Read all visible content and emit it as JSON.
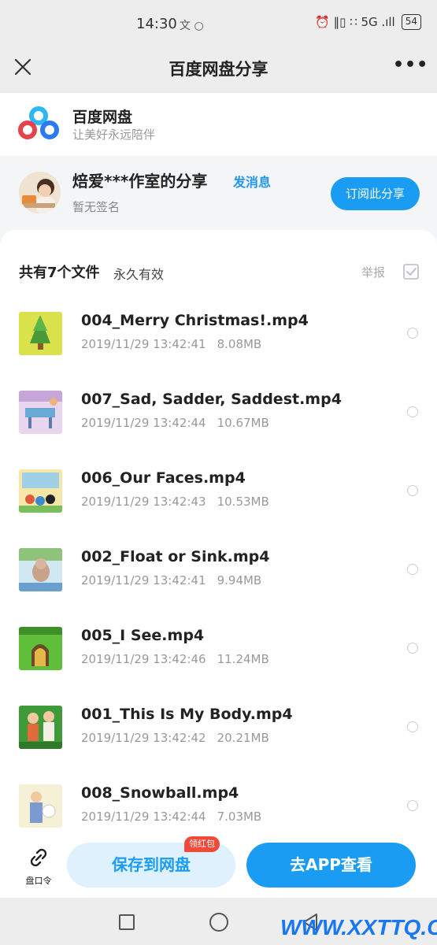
{
  "status_bar": {
    "time": "14:30",
    "time_extra": "文 ○",
    "icons_text": "⏰ ‖▯ ∷ 5G .ıll",
    "battery": "54"
  },
  "title_bar": {
    "title": "百度网盘分享",
    "more": "•••"
  },
  "brand": {
    "name": "百度网盘",
    "slogan": "让美好永远陪伴"
  },
  "sharer": {
    "name": "焙爱***作室的分享",
    "send_message": "发消息",
    "signature": "暂无签名",
    "subscribe": "订阅此分享"
  },
  "file_panel": {
    "count_label": "共有7个文件",
    "validity": "永久有效",
    "report": "举报",
    "files": [
      {
        "name": "004_Merry Christmas!.mp4",
        "date": "2019/11/29 13:42:41",
        "size": "8.08MB",
        "thumb": "tree"
      },
      {
        "name": "007_Sad, Sadder, Saddest.mp4",
        "date": "2019/11/29 13:42:44",
        "size": "10.67MB",
        "thumb": "classroom"
      },
      {
        "name": "006_Our Faces.mp4",
        "date": "2019/11/29 13:42:43",
        "size": "10.53MB",
        "thumb": "faces"
      },
      {
        "name": "002_Float or Sink.mp4",
        "date": "2019/11/29 13:42:41",
        "size": "9.94MB",
        "thumb": "cat"
      },
      {
        "name": "005_I See.mp4",
        "date": "2019/11/29 13:42:46",
        "size": "11.24MB",
        "thumb": "tunnel"
      },
      {
        "name": "001_This Is My Body.mp4",
        "date": "2019/11/29 13:42:42",
        "size": "20.21MB",
        "thumb": "body"
      },
      {
        "name": "008_Snowball.mp4",
        "date": "2019/11/29 13:42:44",
        "size": "7.03MB",
        "thumb": "snowball"
      }
    ]
  },
  "actions": {
    "link_code": "盘口令",
    "save": "保存到网盘",
    "red_packet": "领红包",
    "open_app": "去APP查看"
  },
  "watermark": "WWW.XXTTQ.COM",
  "colors": {
    "accent": "#1a9cf2",
    "badge_red": "#f04a3a"
  }
}
